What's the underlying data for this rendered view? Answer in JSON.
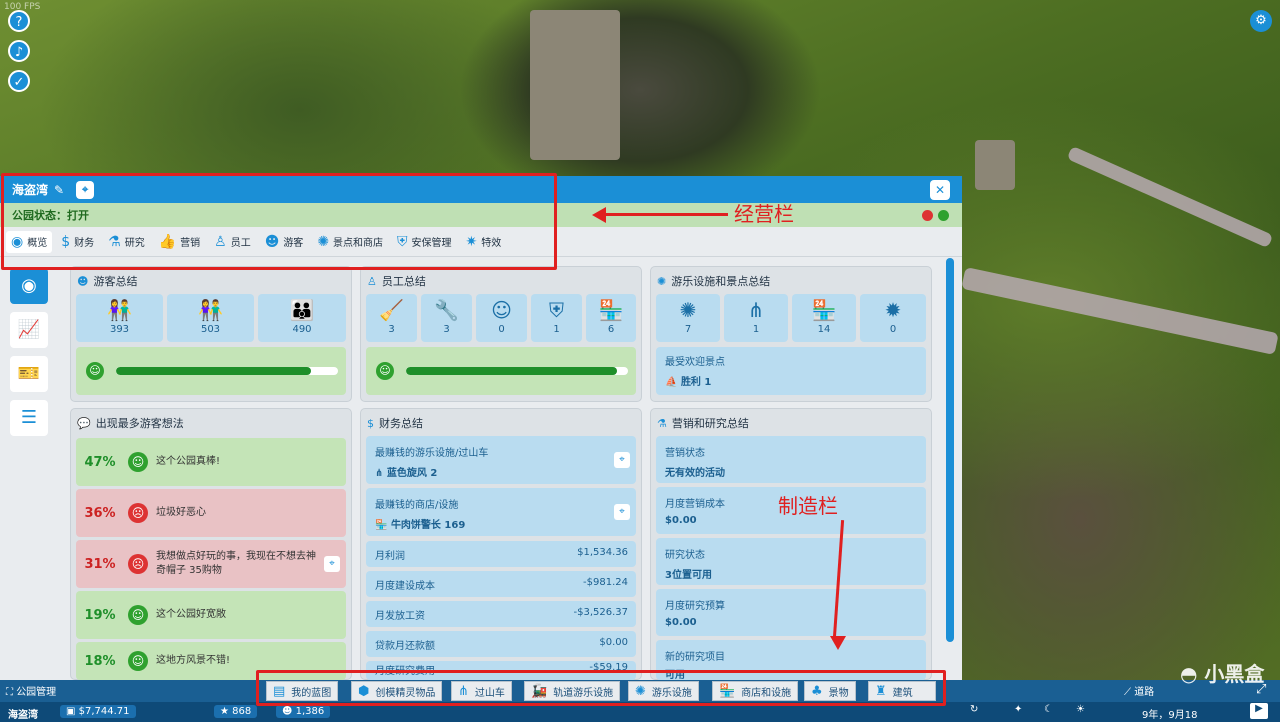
{
  "hud": {
    "fps": "100 FPS"
  },
  "panel": {
    "title": "海盗湾",
    "status": "公园状态：打开",
    "tabs": [
      "概览",
      "财务",
      "研究",
      "营销",
      "员工",
      "游客",
      "景点和商店",
      "安保管理",
      "特效"
    ],
    "guests": {
      "title": "游客总结",
      "values": [
        "393",
        "503",
        "490"
      ],
      "happiness": 0.88
    },
    "staff": {
      "title": "员工总结",
      "values": [
        "3",
        "3",
        "0",
        "1",
        "6"
      ],
      "happiness": 0.95
    },
    "rides": {
      "title": "游乐设施和景点总结",
      "values": [
        "7",
        "1",
        "14",
        "0"
      ],
      "fav_label": "最受欢迎景点",
      "fav_value": "胜利 1"
    },
    "thoughts": {
      "title": "出现最多游客想法",
      "items": [
        {
          "pct": "47%",
          "text": "这个公园真棒!",
          "mood": "good"
        },
        {
          "pct": "36%",
          "text": "垃圾好恶心",
          "mood": "bad"
        },
        {
          "pct": "31%",
          "text": "我想做点好玩的事，我现在不想去神奇帽子 35购物",
          "mood": "bad"
        },
        {
          "pct": "19%",
          "text": "这个公园好宽敞",
          "mood": "good"
        },
        {
          "pct": "18%",
          "text": "这地方风景不错!",
          "mood": "good"
        }
      ]
    },
    "finance": {
      "title": "财务总结",
      "best_ride_label": "最赚钱的游乐设施/过山车",
      "best_ride": "蓝色旋风 2",
      "best_shop_label": "最赚钱的商店/设施",
      "best_shop": "牛肉饼警长 169",
      "rows": [
        [
          "月利润",
          "$1,534.36"
        ],
        [
          "月度建设成本",
          "-$981.24"
        ],
        [
          "月发放工资",
          "-$3,526.37"
        ],
        [
          "贷款月还款额",
          "$0.00"
        ],
        [
          "月度研究费用",
          "-$59.19"
        ]
      ]
    },
    "marketing": {
      "title": "营销和研究总结",
      "items": [
        [
          "营销状态",
          "无有效的活动"
        ],
        [
          "月度营销成本",
          "$0.00"
        ],
        [
          "研究状态",
          "3位置可用"
        ],
        [
          "月度研究预算",
          "$0.00"
        ],
        [
          "新的研究项目",
          "可用"
        ]
      ]
    }
  },
  "annotations": {
    "top": "经营栏",
    "bottom": "制造栏"
  },
  "buildbar": [
    "我的蓝图",
    "创模精灵物品",
    "过山车",
    "轨道游乐设施",
    "游乐设施",
    "商店和设施",
    "景物",
    "建筑"
  ],
  "bottombar": {
    "park_mgmt": "公园管理",
    "park": "海盗湾",
    "money": "$7,744.71",
    "rating": "868",
    "guests": "1,386",
    "path": "道路",
    "date": "9年，9月18",
    "watermark": "小黑盒"
  },
  "colors": {
    "accent": "#1b8fd6",
    "good": "#2fa12f",
    "bad": "#dd3333",
    "annot": "#e02020"
  }
}
